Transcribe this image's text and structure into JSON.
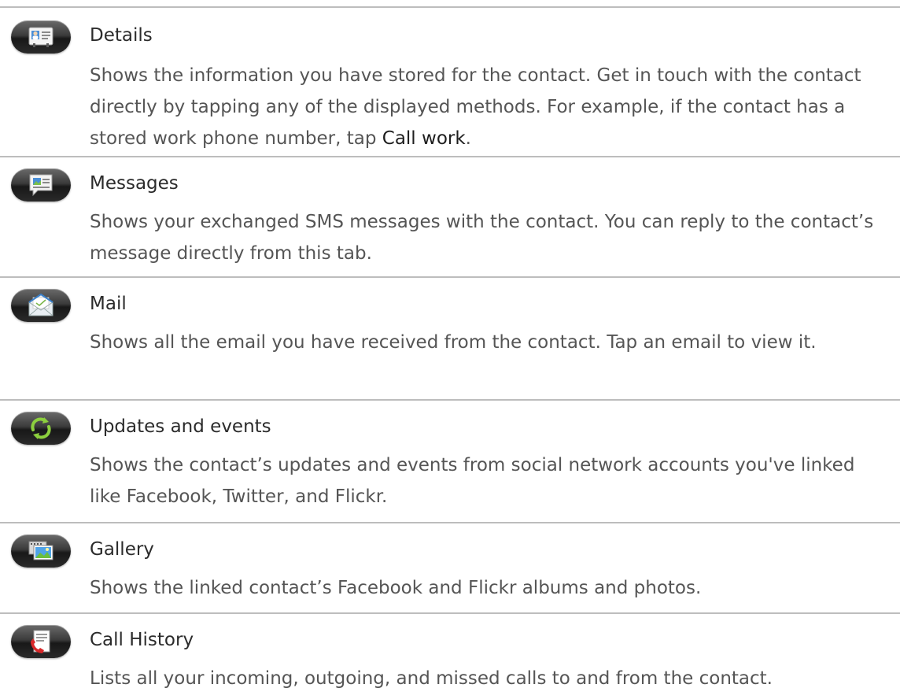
{
  "entries": [
    {
      "icon": "contact-card-icon",
      "title": "Details",
      "desc_before": "Shows the information you have stored for the contact. Get in touch with the contact directly by tapping any of the displayed methods. For example, if the contact has a stored work phone number, tap ",
      "desc_emph": "Call work",
      "desc_after": "."
    },
    {
      "icon": "messages-icon",
      "title": "Messages",
      "desc": "Shows your exchanged SMS messages with the contact. You can reply to the contact’s message directly from this tab."
    },
    {
      "icon": "mail-icon",
      "title": "Mail",
      "desc": "Shows all the email you have received from the contact. Tap an email to view it."
    },
    {
      "icon": "updates-refresh-icon",
      "title": "Updates and events",
      "desc": "Shows the contact’s updates and events from social network accounts you've linked like Facebook, Twitter, and Flickr."
    },
    {
      "icon": "gallery-icon",
      "title": "Gallery",
      "desc": "Shows the linked contact’s Facebook and Flickr albums and photos."
    },
    {
      "icon": "call-history-icon",
      "title": "Call History",
      "desc": "Lists all your incoming, outgoing, and missed calls to and from the contact."
    }
  ]
}
